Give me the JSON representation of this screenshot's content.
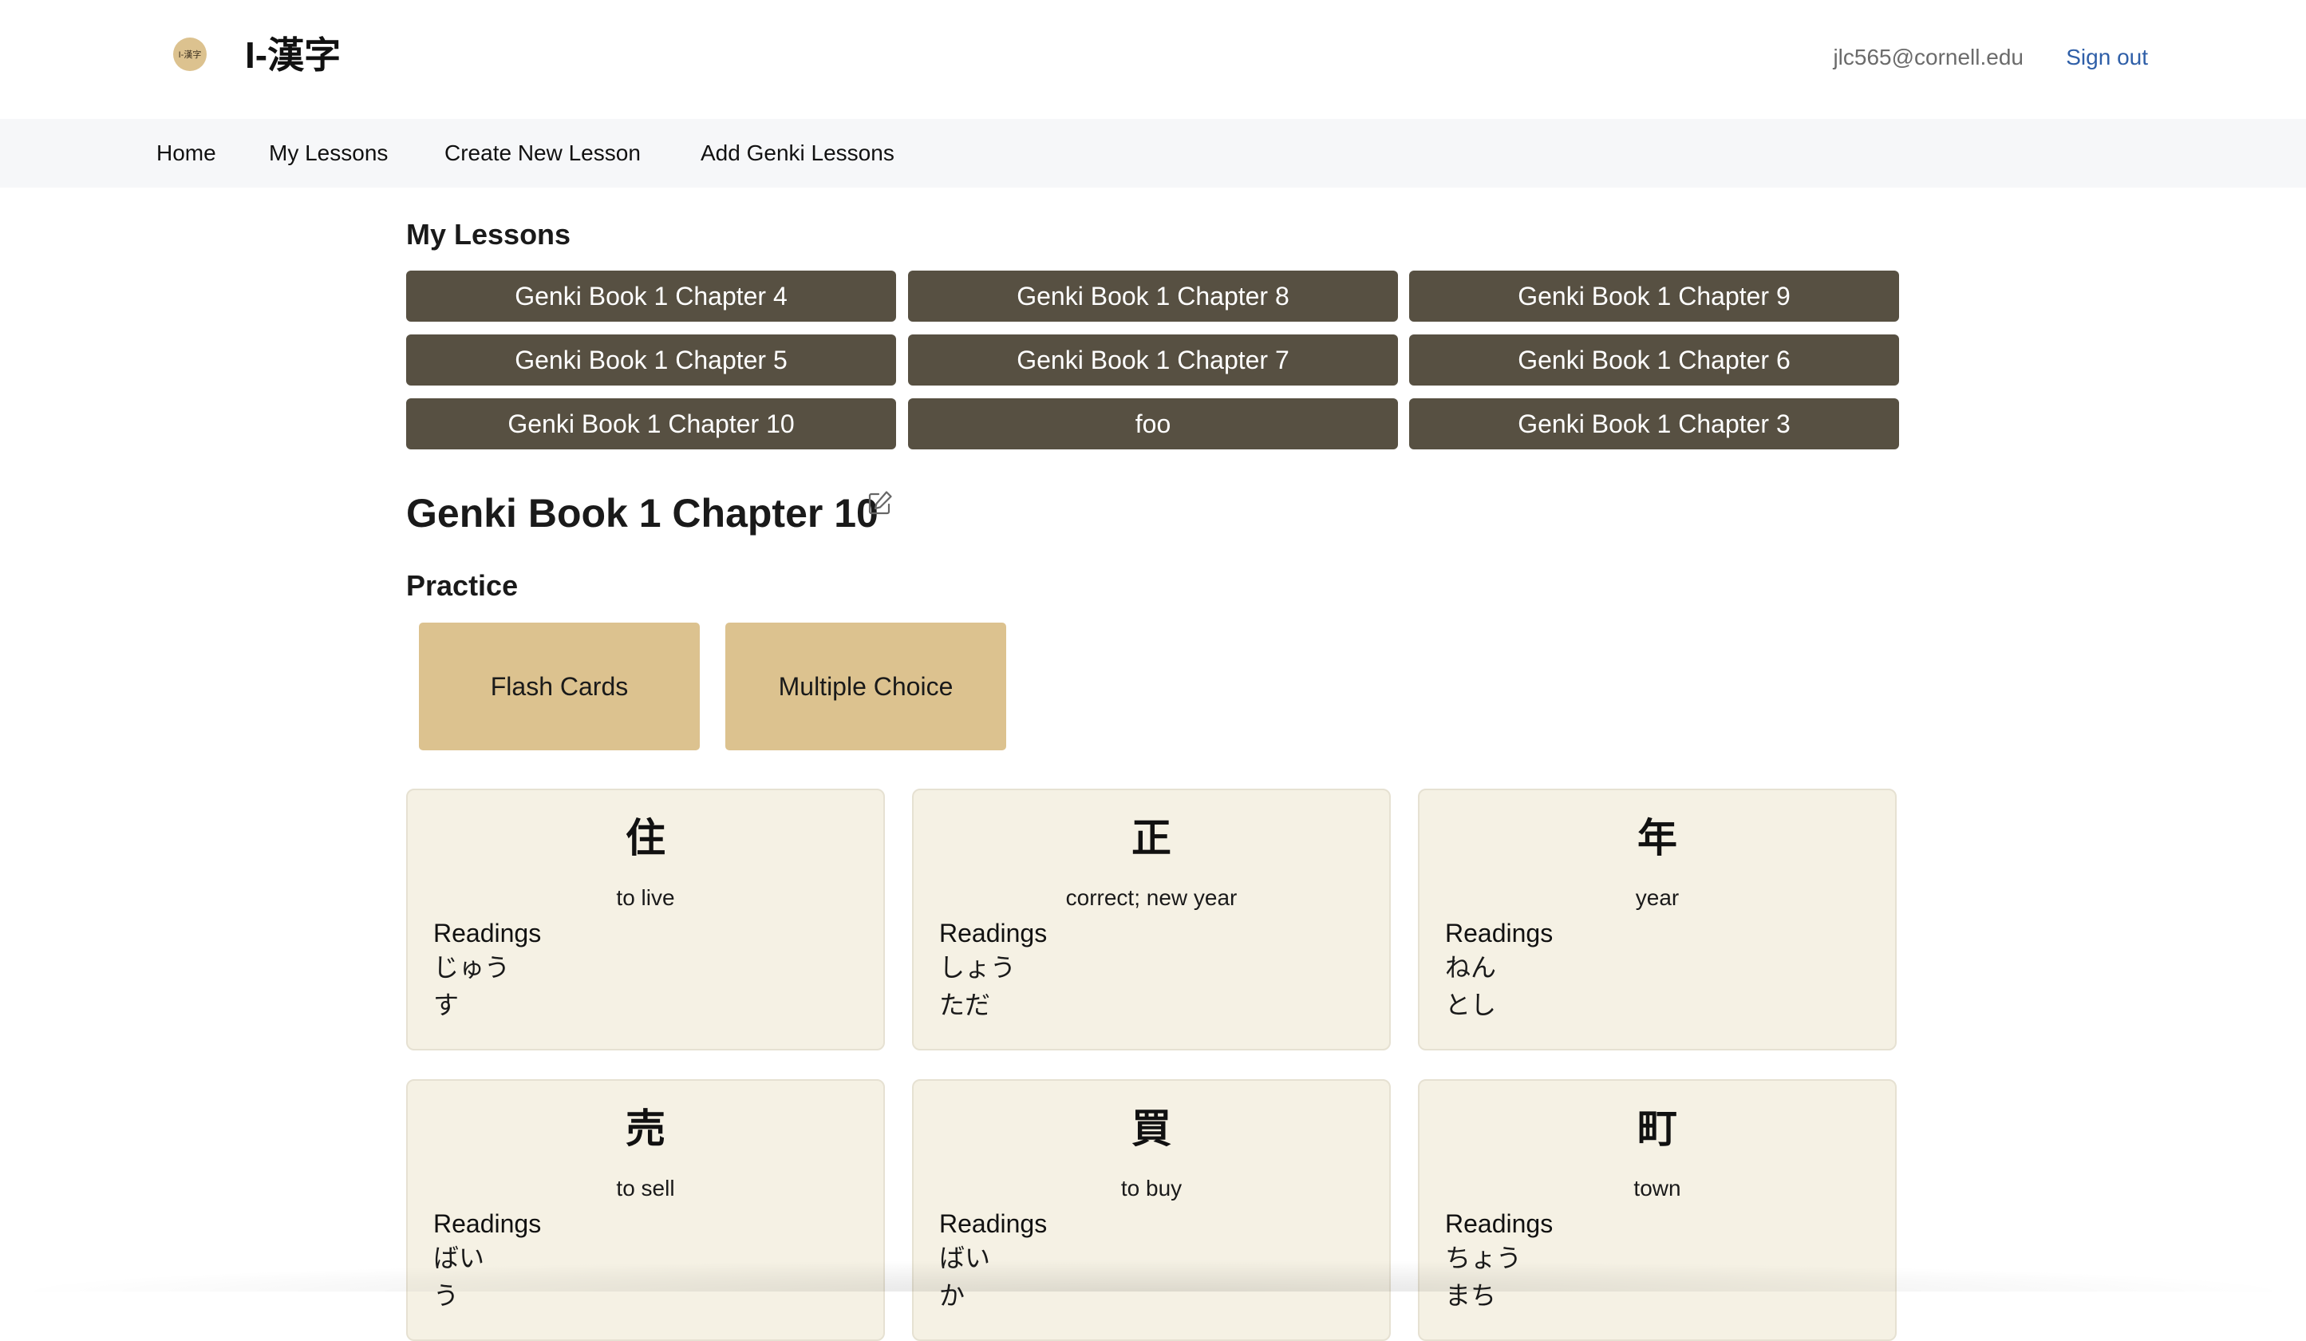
{
  "header": {
    "logo_text": "I-漢字",
    "app_title": "I-漢字",
    "user_email": "jlc565@cornell.edu",
    "sign_out_label": "Sign out"
  },
  "nav": {
    "items": [
      {
        "label": "Home"
      },
      {
        "label": "My Lessons"
      },
      {
        "label": "Create New Lesson"
      },
      {
        "label": "Add Genki Lessons"
      }
    ]
  },
  "my_lessons": {
    "title": "My Lessons",
    "lessons": [
      {
        "label": "Genki Book 1 Chapter 4"
      },
      {
        "label": "Genki Book 1 Chapter 8"
      },
      {
        "label": "Genki Book 1 Chapter 9"
      },
      {
        "label": "Genki Book 1 Chapter 5"
      },
      {
        "label": "Genki Book 1 Chapter 7"
      },
      {
        "label": "Genki Book 1 Chapter 6"
      },
      {
        "label": "Genki Book 1 Chapter 10"
      },
      {
        "label": "foo"
      },
      {
        "label": "Genki Book 1 Chapter 3"
      }
    ]
  },
  "current_lesson": {
    "title": "Genki Book 1 Chapter 10",
    "edit_icon": "edit-icon"
  },
  "practice": {
    "title": "Practice",
    "buttons": [
      {
        "label": "Flash Cards"
      },
      {
        "label": "Multiple Choice"
      }
    ]
  },
  "kanji_cards": {
    "readings_label": "Readings",
    "cards": [
      {
        "kanji": "住",
        "meaning": "to live",
        "readings": [
          "じゅう",
          "す"
        ]
      },
      {
        "kanji": "正",
        "meaning": "correct; new year",
        "readings": [
          "しょう",
          "ただ"
        ]
      },
      {
        "kanji": "年",
        "meaning": "year",
        "readings": [
          "ねん",
          "とし"
        ]
      },
      {
        "kanji": "売",
        "meaning": "to sell",
        "readings": [
          "ばい",
          "う"
        ]
      },
      {
        "kanji": "買",
        "meaning": "to buy",
        "readings": [
          "ばい",
          "か"
        ]
      },
      {
        "kanji": "町",
        "meaning": "town",
        "readings": [
          "ちょう",
          "まち"
        ]
      }
    ]
  },
  "colors": {
    "lesson_button": "#575042",
    "practice_button": "#dcc28f",
    "card_background": "#f5f1e4",
    "nav_background": "#f6f7f9",
    "sign_out_link": "#2f5fa8"
  }
}
